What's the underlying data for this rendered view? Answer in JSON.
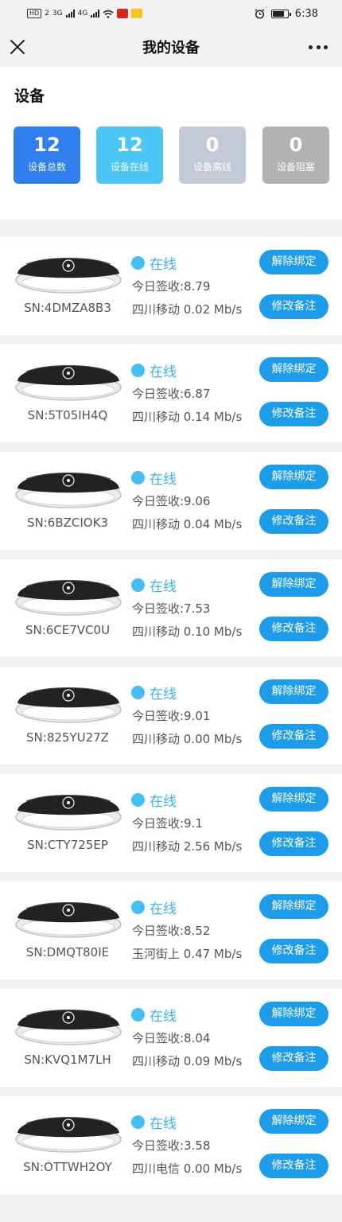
{
  "statusbar": {
    "time": "6:38",
    "hd": "HD",
    "sim": "2",
    "net1": "3G",
    "net2": "4G"
  },
  "navbar": {
    "title": "我的设备"
  },
  "summary": {
    "title": "设备",
    "stats": [
      {
        "value": "12",
        "label": "设备总数",
        "color": "#2f80ee"
      },
      {
        "value": "12",
        "label": "设备在线",
        "color": "#4cc6f5"
      },
      {
        "value": "0",
        "label": "设备离线",
        "color": "#c3cad6"
      },
      {
        "value": "0",
        "label": "设备阻塞",
        "color": "#b2b2b2"
      }
    ]
  },
  "devices": [
    {
      "sn": "SN:4DMZA8B3",
      "status": "在线",
      "sign": "今日签收:8.79",
      "isp": "四川移动  0.02 Mb/s",
      "unbind": "解除绑定",
      "remark": "修改备注"
    },
    {
      "sn": "SN:5T05IH4Q",
      "status": "在线",
      "sign": "今日签收:6.87",
      "isp": "四川移动  0.14 Mb/s",
      "unbind": "解除绑定",
      "remark": "修改备注"
    },
    {
      "sn": "SN:6BZCIOK3",
      "status": "在线",
      "sign": "今日签收:9.06",
      "isp": "四川移动  0.04 Mb/s",
      "unbind": "解除绑定",
      "remark": "修改备注"
    },
    {
      "sn": "SN:6CE7VC0U",
      "status": "在线",
      "sign": "今日签收:7.53",
      "isp": "四川移动  0.10 Mb/s",
      "unbind": "解除绑定",
      "remark": "修改备注"
    },
    {
      "sn": "SN:825YU27Z",
      "status": "在线",
      "sign": "今日签收:9.01",
      "isp": "四川移动  0.00 Mb/s",
      "unbind": "解除绑定",
      "remark": "修改备注"
    },
    {
      "sn": "SN:CTY725EP",
      "status": "在线",
      "sign": "今日签收:9.1",
      "isp": "四川移动  2.56 Mb/s",
      "unbind": "解除绑定",
      "remark": "修改备注"
    },
    {
      "sn": "SN:DMQT80IE",
      "status": "在线",
      "sign": "今日签收:8.52",
      "isp": "玉河街上  0.47 Mb/s",
      "unbind": "解除绑定",
      "remark": "修改备注"
    },
    {
      "sn": "SN:KVQ1M7LH",
      "status": "在线",
      "sign": "今日签收:8.04",
      "isp": "四川移动  0.09 Mb/s",
      "unbind": "解除绑定",
      "remark": "修改备注"
    },
    {
      "sn": "SN:OTTWH2OY",
      "status": "在线",
      "sign": "今日签收:3.58",
      "isp": "四川电信  0.00 Mb/s",
      "unbind": "解除绑定",
      "remark": "修改备注"
    }
  ]
}
